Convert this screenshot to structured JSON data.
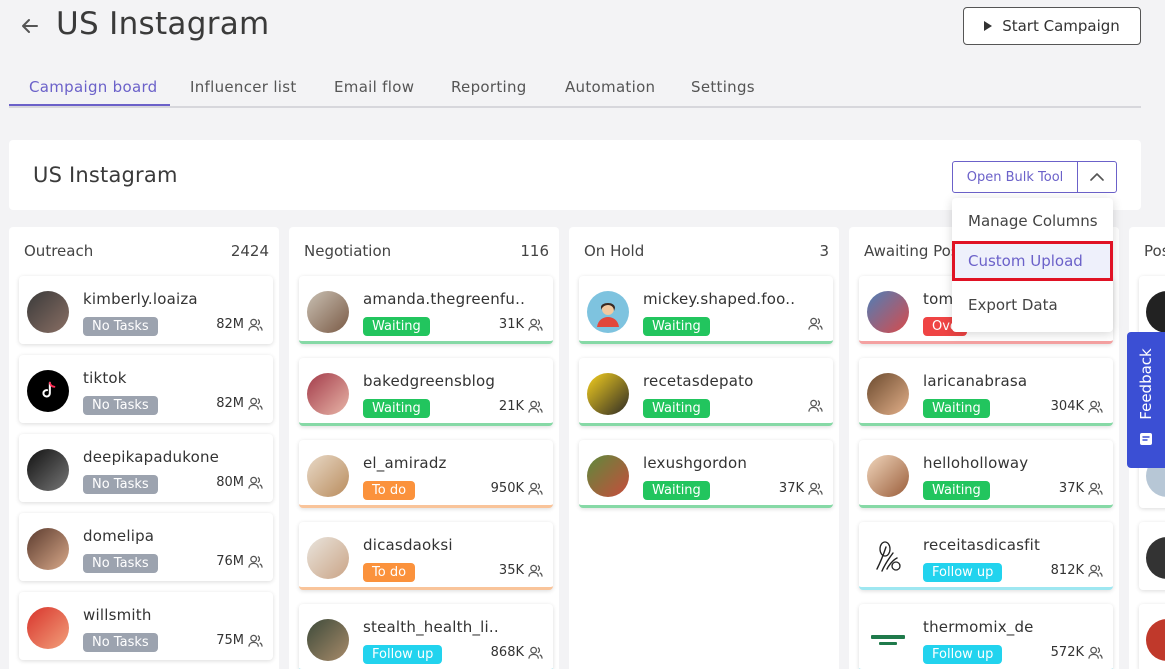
{
  "page": {
    "title": "US Instagram",
    "start_campaign_label": "Start Campaign"
  },
  "tabs": [
    {
      "label": "Campaign board",
      "active": true
    },
    {
      "label": "Influencer list",
      "active": false
    },
    {
      "label": "Email flow",
      "active": false
    },
    {
      "label": "Reporting",
      "active": false
    },
    {
      "label": "Automation",
      "active": false
    },
    {
      "label": "Settings",
      "active": false
    }
  ],
  "board": {
    "title": "US Instagram",
    "bulk_tool_label": "Open Bulk Tool"
  },
  "dropdown": {
    "items": [
      {
        "label": "Manage Columns"
      },
      {
        "label": "Custom Upload"
      },
      {
        "label": "Export Data"
      }
    ]
  },
  "feedback_label": "Feedback",
  "colors": {
    "accent": "#6b61c9",
    "waiting": "#22c55e",
    "todo": "#fb923c",
    "no_tasks": "#9ca3af",
    "follow_up": "#22d3ee",
    "overdue": "#ef4444",
    "highlight_border": "#e01224",
    "feedback": "#3b4fd4"
  },
  "columns": [
    {
      "name": "Outreach",
      "count": "2424",
      "cards": [
        {
          "name": "kimberly.loaiza",
          "status": "No Tasks",
          "followers": "82M"
        },
        {
          "name": "tiktok",
          "status": "No Tasks",
          "followers": "82M"
        },
        {
          "name": "deepikapadukone",
          "status": "No Tasks",
          "followers": "80M"
        },
        {
          "name": "domelipa",
          "status": "No Tasks",
          "followers": "76M"
        },
        {
          "name": "willsmith",
          "status": "No Tasks",
          "followers": "75M"
        }
      ]
    },
    {
      "name": "Negotiation",
      "count": "116",
      "cards": [
        {
          "name": "amanda.thegreenfu..",
          "status": "Waiting",
          "followers": "31K"
        },
        {
          "name": "bakedgreensblog",
          "status": "Waiting",
          "followers": "21K"
        },
        {
          "name": "el_amiradz",
          "status": "To do",
          "followers": "950K"
        },
        {
          "name": "dicasdaoksi",
          "status": "To do",
          "followers": "35K"
        },
        {
          "name": "stealth_health_li..",
          "status": "Follow up",
          "followers": "868K"
        }
      ]
    },
    {
      "name": "On Hold",
      "count": "3",
      "cards": [
        {
          "name": "mickey.shaped.foo..",
          "status": "Waiting",
          "followers": ""
        },
        {
          "name": "recetasdepato",
          "status": "Waiting",
          "followers": ""
        },
        {
          "name": "lexushgordon",
          "status": "Waiting",
          "followers": "37K"
        }
      ]
    },
    {
      "name": "Awaiting Pos",
      "count": "",
      "cards": [
        {
          "name": "toml",
          "status": "Ove",
          "followers": ""
        },
        {
          "name": "laricanabrasa",
          "status": "Waiting",
          "followers": "304K"
        },
        {
          "name": "helloholloway",
          "status": "Waiting",
          "followers": "37K"
        },
        {
          "name": "receitasdicasfit",
          "status": "Follow up",
          "followers": "812K"
        },
        {
          "name": "thermomix_de",
          "status": "Follow up",
          "followers": "572K"
        }
      ]
    },
    {
      "name": "Pos",
      "count": "",
      "cards": []
    }
  ]
}
